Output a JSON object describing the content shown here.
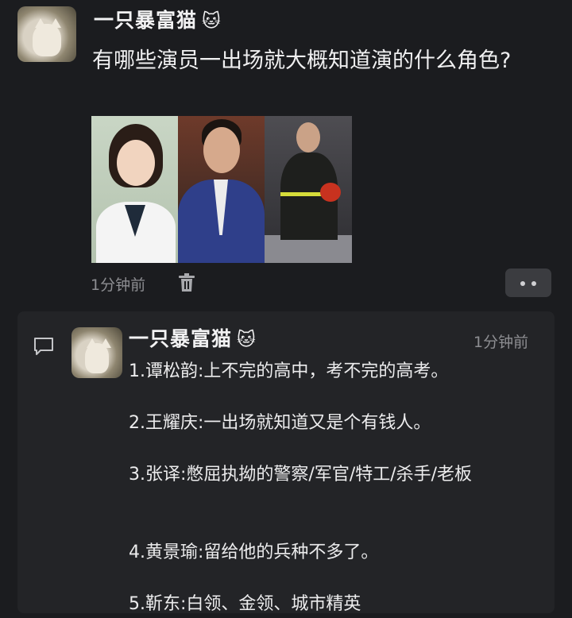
{
  "post": {
    "author": "一只暴富猫",
    "author_emoji": "🐱",
    "text": "有哪些演员一出场就大概知道演的什么角色?",
    "time": "1分钟前"
  },
  "comment": {
    "author": "一只暴富猫",
    "author_emoji": "🐱",
    "time": "1分钟前",
    "lines": [
      "1.谭松韵:上不完的高中，考不完的高考。",
      "2.王耀庆:一出场就知道又是个有钱人。",
      "3.张译:憋屈执拗的警察/军官/特工/杀手/老板",
      "4.黄景瑜:留给他的兵种不多了。",
      "5.靳东:白领、金领、城市精英"
    ]
  },
  "icons": {
    "delete": "trash-icon",
    "more": "more-icon",
    "comment": "comment-icon"
  },
  "colors": {
    "background": "#1b1c1f",
    "panel": "#232427",
    "muted_text": "#8d8e92"
  }
}
